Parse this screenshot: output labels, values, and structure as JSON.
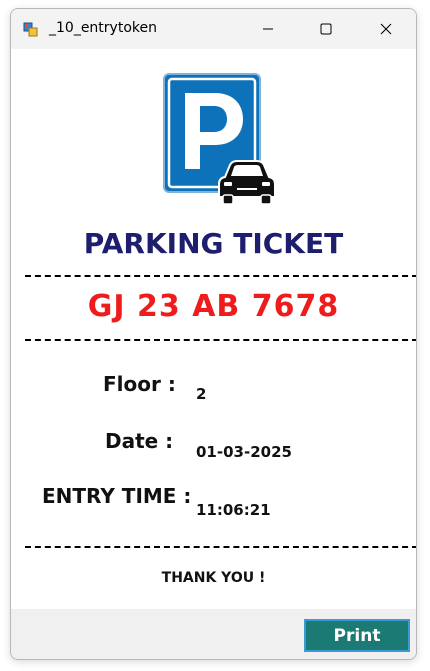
{
  "window": {
    "title": "_10_entrytoken"
  },
  "icons": {
    "app": "app-window-icon",
    "minimize": "minimize-icon",
    "maximize": "maximize-icon",
    "close": "close-icon",
    "logo": "parking-car-icon"
  },
  "ticket": {
    "heading": "PARKING TICKET",
    "plate": "GJ 23 AB 7678",
    "floor_label": "Floor :",
    "floor_value": "2",
    "date_label": "Date :",
    "date_value": "01-03-2025",
    "time_label": "ENTRY TIME :",
    "time_value": "11:06:21",
    "thanks": "THANK YOU !"
  },
  "footer": {
    "print_label": "Print"
  },
  "colors": {
    "heading": "#1e1e6e",
    "plate": "#ee1c1c",
    "parking_blue": "#0d72b9",
    "print_button": "#1b7a74"
  }
}
